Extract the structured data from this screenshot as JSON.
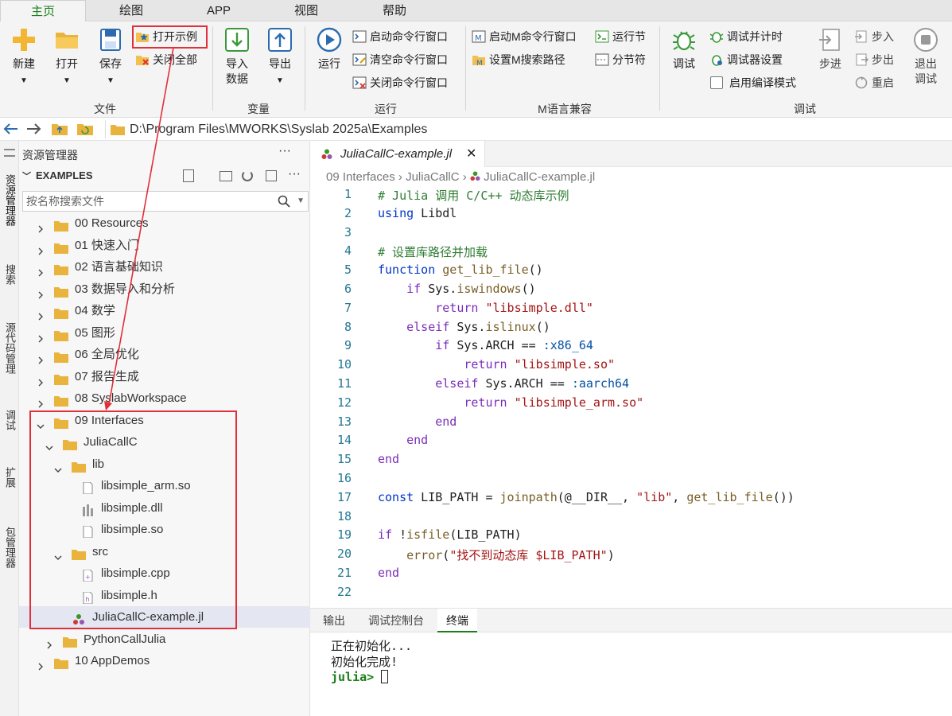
{
  "ribbon_tabs": [
    "主页",
    "绘图",
    "APP",
    "视图",
    "帮助"
  ],
  "ribbon": {
    "file": {
      "new": "新建",
      "open": "打开",
      "save": "保存",
      "open_example": "打开示例",
      "close_all": "关闭全部",
      "group": "文件"
    },
    "variable": {
      "import_line1": "导入",
      "import_line2": "数据",
      "export": "导出",
      "group": "变量"
    },
    "run": {
      "run": "运行",
      "start_cmd": "启动命令行窗口",
      "clear_cmd": "清空命令行窗口",
      "close_cmd": "关闭命令行窗口",
      "group": "运行"
    },
    "m": {
      "start_m": "启动M命令行窗口",
      "set_m_path": "设置M搜索路径",
      "run_section": "运行节",
      "section_sep": "分节符",
      "group": "M语言兼容"
    },
    "debug": {
      "debug": "调试",
      "debug_timing": "调试并计时",
      "debugger_settings": "调试器设置",
      "compile_mode": "启用编译模式",
      "step": "步进",
      "step_in": "步入",
      "step_out": "步出",
      "restart": "重启",
      "exit_line1": "退出",
      "exit_line2": "调试",
      "group": "调试"
    }
  },
  "address": {
    "path": "D:\\Program Files\\MWORKS\\Syslab 2025a\\Examples"
  },
  "activity_bar": [
    "资源管理器",
    "搜索",
    "源代码管理",
    "调试",
    "扩展",
    "包管理器"
  ],
  "explorer": {
    "title": "资源管理器",
    "more": "···",
    "section": "EXAMPLES",
    "search_placeholder": "按名称搜索文件",
    "tree": [
      {
        "label": "00 Resources",
        "type": "folder",
        "depth": 0,
        "open": false
      },
      {
        "label": "01 快速入门",
        "type": "folder",
        "depth": 0,
        "open": false
      },
      {
        "label": "02 语言基础知识",
        "type": "folder",
        "depth": 0,
        "open": false
      },
      {
        "label": "03 数据导入和分析",
        "type": "folder",
        "depth": 0,
        "open": false
      },
      {
        "label": "04 数学",
        "type": "folder",
        "depth": 0,
        "open": false
      },
      {
        "label": "05 图形",
        "type": "folder",
        "depth": 0,
        "open": false
      },
      {
        "label": "06 全局优化",
        "type": "folder",
        "depth": 0,
        "open": false
      },
      {
        "label": "07 报告生成",
        "type": "folder",
        "depth": 0,
        "open": false
      },
      {
        "label": "08 SyslabWorkspace",
        "type": "folder",
        "depth": 0,
        "open": false
      },
      {
        "label": "09 Interfaces",
        "type": "folder",
        "depth": 0,
        "open": true
      },
      {
        "label": "JuliaCallC",
        "type": "folder",
        "depth": 1,
        "open": true
      },
      {
        "label": "lib",
        "type": "folder",
        "depth": 2,
        "open": true
      },
      {
        "label": "libsimple_arm.so",
        "type": "file",
        "depth": 3
      },
      {
        "label": "libsimple.dll",
        "type": "dll",
        "depth": 3
      },
      {
        "label": "libsimple.so",
        "type": "file",
        "depth": 3
      },
      {
        "label": "src",
        "type": "folder",
        "depth": 2,
        "open": true
      },
      {
        "label": "libsimple.cpp",
        "type": "cpp",
        "depth": 3
      },
      {
        "label": "libsimple.h",
        "type": "h",
        "depth": 3
      },
      {
        "label": "JuliaCallC-example.jl",
        "type": "jl",
        "depth": 2,
        "selected": true
      },
      {
        "label": "PythonCallJulia",
        "type": "folder",
        "depth": 1,
        "open": false
      },
      {
        "label": "10 AppDemos",
        "type": "folder",
        "depth": 0,
        "open": false
      }
    ]
  },
  "editor": {
    "tab": "JuliaCallC-example.jl",
    "breadcrumb": [
      "09 Interfaces",
      "JuliaCallC",
      "JuliaCallC-example.jl"
    ],
    "line_numbers": [
      "1",
      "2",
      "3",
      "4",
      "5",
      "6",
      "7",
      "8",
      "9",
      "10",
      "11",
      "12",
      "13",
      "14",
      "15",
      "16",
      "17",
      "18",
      "19",
      "20",
      "21",
      "22"
    ],
    "lines": [
      "# Julia 调用 C/C++ 动态库示例",
      "using Libdl",
      "",
      "# 设置库路径并加载",
      "function get_lib_file()",
      "    if Sys.iswindows()",
      "        return \"libsimple.dll\"",
      "    elseif Sys.islinux()",
      "        if Sys.ARCH == :x86_64",
      "            return \"libsimple.so\"",
      "        elseif Sys.ARCH == :aarch64",
      "            return \"libsimple_arm.so\"",
      "        end",
      "    end",
      "end",
      "",
      "const LIB_PATH = joinpath(@__DIR__, \"lib\", get_lib_file())",
      "",
      "if !isfile(LIB_PATH)",
      "    error(\"找不到动态库 $LIB_PATH\")",
      "end",
      ""
    ]
  },
  "panel": {
    "tabs": [
      "输出",
      "调试控制台",
      "终端"
    ],
    "active": "终端",
    "terminal": [
      "正在初始化...",
      "初始化完成!"
    ],
    "prompt": "julia>"
  }
}
